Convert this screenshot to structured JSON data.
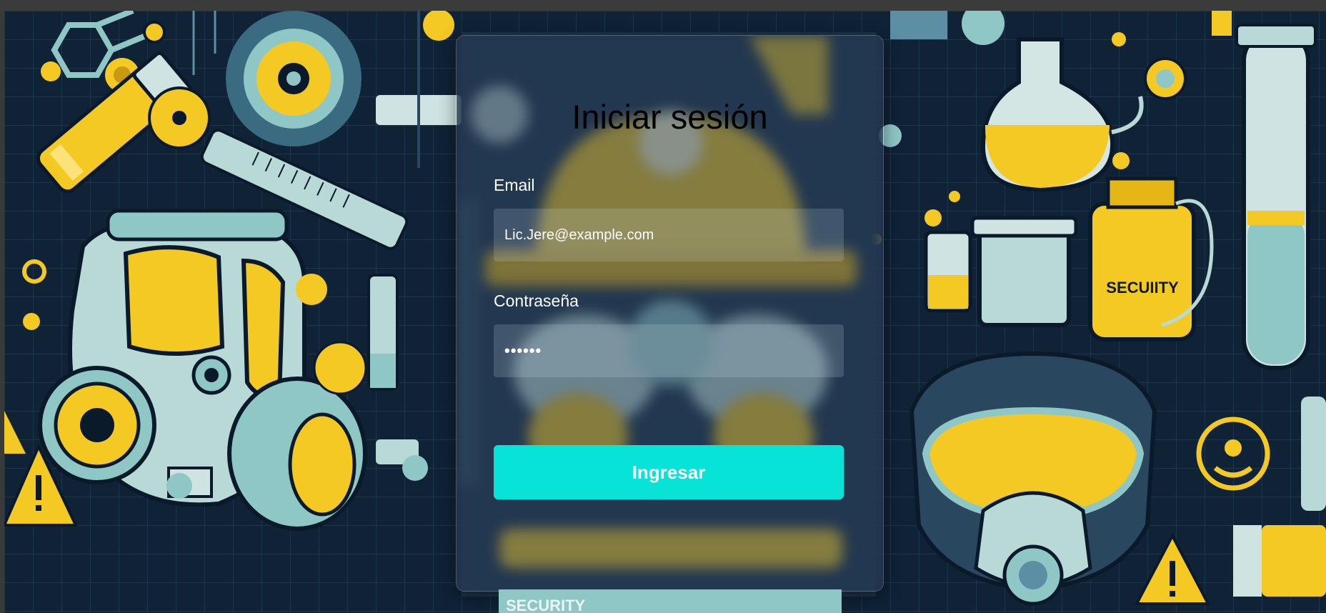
{
  "login": {
    "title": "Iniciar sesión",
    "email_label": "Email",
    "email_value": "Lic.Jere@example.com",
    "password_label": "Contraseña",
    "password_value": "••••••",
    "submit_label": "Ingresar"
  },
  "background": {
    "bottle_label": "SECUIITY",
    "card_bottom_label": "SECURITY"
  },
  "colors": {
    "navy": "#0f2236",
    "teal": "#8fc7c6",
    "yellow": "#f5c923",
    "button": "#08e3d7"
  }
}
